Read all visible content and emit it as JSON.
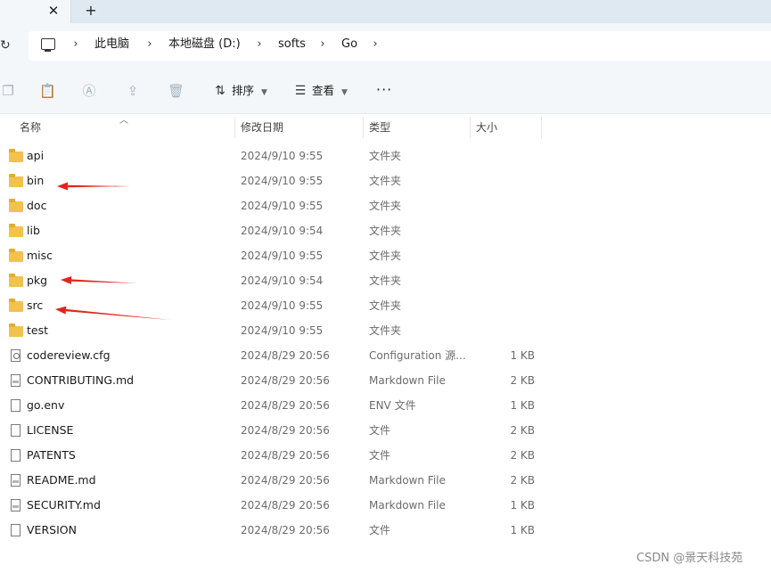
{
  "tabs": {
    "close_glyph": "✕",
    "new_glyph": "+"
  },
  "address": {
    "crumbs": [
      "此电脑",
      "本地磁盘 (D:)",
      "softs",
      "Go"
    ],
    "separator": "›"
  },
  "toolbar": {
    "sort_label": "排序",
    "view_label": "查看",
    "more_label": "···"
  },
  "columns": {
    "name": "名称",
    "date": "修改日期",
    "type": "类型",
    "size": "大小"
  },
  "files": [
    {
      "name": "api",
      "date": "2024/9/10 9:55",
      "type": "文件夹",
      "size": "",
      "icon": "folder-icon"
    },
    {
      "name": "bin",
      "date": "2024/9/10 9:55",
      "type": "文件夹",
      "size": "",
      "icon": "folder-icon"
    },
    {
      "name": "doc",
      "date": "2024/9/10 9:55",
      "type": "文件夹",
      "size": "",
      "icon": "folder-icon"
    },
    {
      "name": "lib",
      "date": "2024/9/10 9:54",
      "type": "文件夹",
      "size": "",
      "icon": "folder-icon"
    },
    {
      "name": "misc",
      "date": "2024/9/10 9:55",
      "type": "文件夹",
      "size": "",
      "icon": "folder-icon"
    },
    {
      "name": "pkg",
      "date": "2024/9/10 9:54",
      "type": "文件夹",
      "size": "",
      "icon": "folder-icon"
    },
    {
      "name": "src",
      "date": "2024/9/10 9:55",
      "type": "文件夹",
      "size": "",
      "icon": "folder-icon"
    },
    {
      "name": "test",
      "date": "2024/9/10 9:55",
      "type": "文件夹",
      "size": "",
      "icon": "folder-icon"
    },
    {
      "name": "codereview.cfg",
      "date": "2024/8/29 20:56",
      "type": "Configuration 源...",
      "size": "1 KB",
      "icon": "config-file-icon"
    },
    {
      "name": "CONTRIBUTING.md",
      "date": "2024/8/29 20:56",
      "type": "Markdown File",
      "size": "2 KB",
      "icon": "markdown-file-icon"
    },
    {
      "name": "go.env",
      "date": "2024/8/29 20:56",
      "type": "ENV 文件",
      "size": "1 KB",
      "icon": "file-icon"
    },
    {
      "name": "LICENSE",
      "date": "2024/8/29 20:56",
      "type": "文件",
      "size": "2 KB",
      "icon": "file-icon"
    },
    {
      "name": "PATENTS",
      "date": "2024/8/29 20:56",
      "type": "文件",
      "size": "2 KB",
      "icon": "file-icon"
    },
    {
      "name": "README.md",
      "date": "2024/8/29 20:56",
      "type": "Markdown File",
      "size": "2 KB",
      "icon": "markdown-file-icon"
    },
    {
      "name": "SECURITY.md",
      "date": "2024/8/29 20:56",
      "type": "Markdown File",
      "size": "1 KB",
      "icon": "markdown-file-icon"
    },
    {
      "name": "VERSION",
      "date": "2024/8/29 20:56",
      "type": "文件",
      "size": "1 KB",
      "icon": "file-icon"
    }
  ],
  "annotation_color": "#e0261b",
  "watermark": "CSDN @景天科技苑"
}
